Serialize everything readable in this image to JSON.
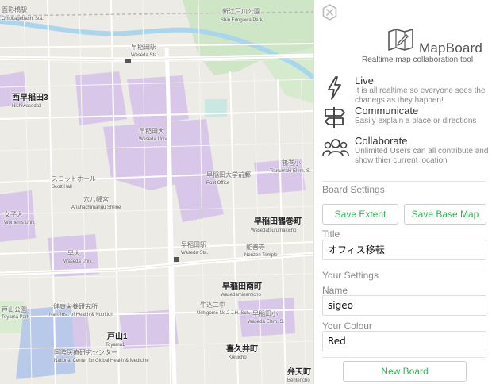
{
  "map": {
    "labels": {
      "omokagebashi": "面影橋駅",
      "omokagebashi_en": "Omokagebashi Sta.",
      "shinmei": "新江戸川公園",
      "shinmei_en": "Shin Edogawa Park",
      "waseda_sta_top": "早稲田駅",
      "waseda_sta_top_en": "Waseda Sta.",
      "nishiwaseda": "西早稲田3",
      "nishiwaseda_en": "Nishiwaseda3",
      "waseda_univ": "早稲田大",
      "waseda_univ_en": "Waseda Univ.",
      "scott_hall": "スコットホール",
      "scott_hall_en": "Scott Hall",
      "anahachiman": "穴八幡宮",
      "anahachiman_en": "Anahachimangu Shrine",
      "waseda_po": "早稲田大学前郵",
      "waseda_po_en": "Post Office",
      "tsurumaki": "早稲田鶴巻町",
      "tsurumaki_en": "Wasedatsurumakicho",
      "waseda_sta_mid": "早稲田駅",
      "waseda_sta_mid_en": "Waseda Sta.",
      "gokoji": "能善寺",
      "gokoji_en": "Nouzen Temple",
      "waseda_small": "早大",
      "waseda_small_en": "Waseda Univ.",
      "minamicho": "早稲田南町",
      "minamicho_en": "Wasedaminamicho",
      "toyama_park": "戸山公園",
      "toyama_park_en": "Toyama Park",
      "nih": "健康栄養研究所",
      "nih_en": "Natl. Inst. of Health & Nutrition",
      "toyama": "戸山1",
      "toyama_en": "Toyama1",
      "ncgm": "国際医療研究センター",
      "ncgm_en": "National Center for Global Health & Medicine",
      "kikuicho": "喜久井町",
      "kikuicho_en": "Kikuicho",
      "bentencho": "弁天町",
      "bentencho_en": "Bentencho",
      "tsurumaki_school": "鶴巻小",
      "tsurumaki_school_en": "Tsurumaki Elem. S.",
      "waseda_school": "早稲田小",
      "waseda_school_en": "Waseda Elem. S.",
      "junior_high": "牛込二中",
      "junior_high_en": "Ushigome No.2 J.H. Sch.",
      "jodai": "女子大",
      "jodai_en": "Women's Univ."
    }
  },
  "panel": {
    "close_icon": "close-circle-icon",
    "app_title": "MapBoard",
    "app_subtitle": "Realtime map collaboration tool",
    "features": [
      {
        "icon": "lightning-icon",
        "title": "Live",
        "desc": "It is all realtime so everyone sees the chanegs as they happen!"
      },
      {
        "icon": "signpost-icon",
        "title": "Communicate",
        "desc": "Easily explain a place or directions"
      },
      {
        "icon": "group-icon",
        "title": "Collaborate",
        "desc": "Unlimited Users can all contribute and show thier current location"
      }
    ],
    "board_settings_label": "Board Settings",
    "save_extent_label": "Save Extent",
    "save_base_map_label": "Save Base Map",
    "title_label": "Title",
    "title_value": "オフィス移転",
    "your_settings_label": "Your Settings",
    "name_label": "Name",
    "name_value": "sigeo",
    "colour_label": "Your Colour",
    "colour_value": "Red",
    "new_board_label": "New Board",
    "accent_color": "#2db852"
  }
}
